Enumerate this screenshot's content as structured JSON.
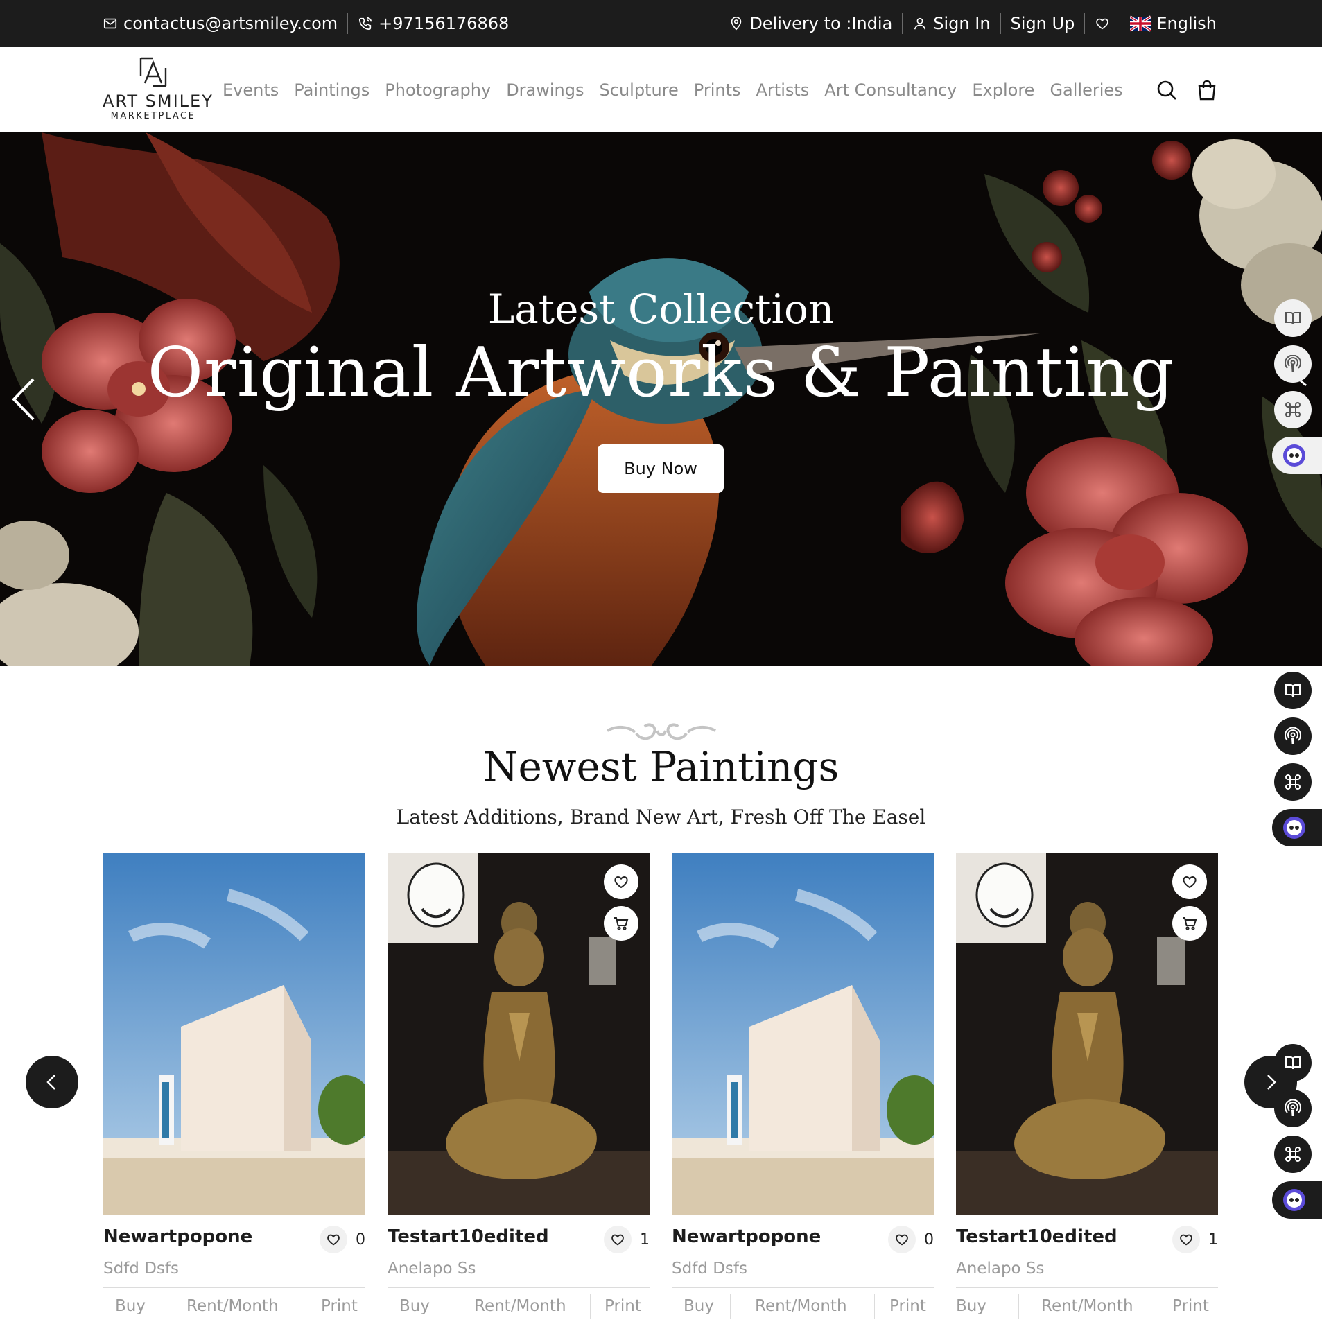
{
  "topbar": {
    "email": "contactus@artsmiley.com",
    "phone": "+97156176868",
    "delivery": "Delivery to :India",
    "sign_in": "Sign In",
    "sign_up": "Sign Up",
    "language": "English"
  },
  "logo": {
    "title": "ART SMILEY",
    "subtitle": "MARKETPLACE"
  },
  "menu": [
    "Events",
    "Paintings",
    "Photography",
    "Drawings",
    "Sculpture",
    "Prints",
    "Artists",
    "Art Consultancy",
    "Explore",
    "Galleries"
  ],
  "hero": {
    "subtitle": "Latest Collection",
    "title": "Original Artworks & Painting",
    "button": "Buy Now"
  },
  "section": {
    "title": "Newest Paintings",
    "subtitle": "Latest Additions, Brand New Art, Fresh Off The Easel"
  },
  "cards": [
    {
      "name": "Newartpopone",
      "artist": "Sdfd Dsfs",
      "likes": "0",
      "image": "building-photo",
      "actions": [
        "Buy",
        "Rent/Month",
        "Print"
      ]
    },
    {
      "name": "Testart10edited",
      "artist": "Anelapo Ss",
      "likes": "1",
      "image": "yoga-sculpture-photo",
      "actions": [
        "Buy",
        "Rent/Month",
        "Print"
      ]
    },
    {
      "name": "Newartpopone",
      "artist": "Sdfd Dsfs",
      "likes": "0",
      "image": "building-photo",
      "actions": [
        "Buy",
        "Rent/Month",
        "Print"
      ]
    },
    {
      "name": "Testart10edited",
      "artist": "Anelapo Ss",
      "likes": "1",
      "image": "yoga-sculpture-photo",
      "actions": [
        "Buy",
        "Rent/Month",
        "Print"
      ]
    }
  ],
  "icons": {
    "mail": "mail-icon",
    "phone": "phone-icon",
    "location": "location-pin-icon",
    "user": "user-icon",
    "wishlist": "heart-icon",
    "flag": "uk-flag-icon",
    "search": "search-icon",
    "cart": "shopping-bag-icon",
    "widget": [
      "book-icon",
      "podcast-icon",
      "apps-grid-icon",
      "chatbot-icon"
    ]
  },
  "colors": {
    "topbar": "#1c1c1c",
    "menu_text": "#8a8a8a",
    "muted": "#9b9b9b",
    "button_bg": "#ffffff"
  }
}
